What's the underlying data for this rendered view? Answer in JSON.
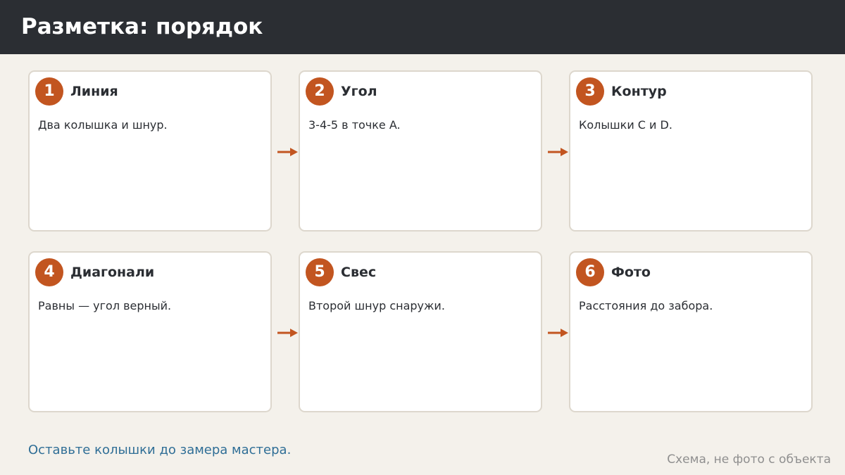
{
  "header": {
    "title": "Разметка: порядок"
  },
  "steps": [
    {
      "number": "1",
      "title": "Линия",
      "text": "Два колышка и шнур."
    },
    {
      "number": "2",
      "title": "Угол",
      "text": "3-4-5 в точке A."
    },
    {
      "number": "3",
      "title": "Контур",
      "text": "Колышки C и D."
    },
    {
      "number": "4",
      "title": "Диагонали",
      "text": "Равны — угол верный."
    },
    {
      "number": "5",
      "title": "Свес",
      "text": "Второй шнур снаружи."
    },
    {
      "number": "6",
      "title": "Фото",
      "text": "Расстояния до забора."
    }
  ],
  "footer": {
    "note": "Оставьте колышки до замера мастера.",
    "caption": "Схема, не фото с объекта"
  },
  "colors": {
    "header_bg": "#2b2e33",
    "accent": "#c25520",
    "note": "#2f6e96",
    "background": "#f4f1eb"
  },
  "icons": {
    "connector": "arrow-right-icon"
  }
}
